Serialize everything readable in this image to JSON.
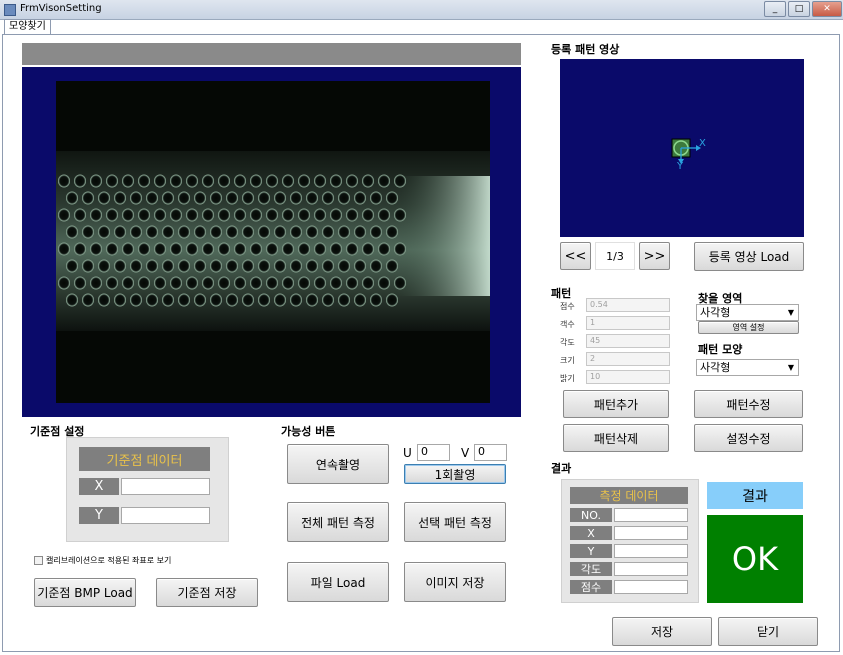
{
  "window": {
    "title": "FrmVisonSetting",
    "tab": "모양찾기"
  },
  "colors": {
    "accent_yellow": "#e9c24a",
    "navy": "#0a0a6a",
    "ok_green": "#008000",
    "result_blue": "#87cefa"
  },
  "reference": {
    "heading": "기준점 설정",
    "data_header": "기준점 데이터",
    "x_label": "X",
    "y_label": "Y",
    "x_value": "",
    "y_value": "",
    "calib_checkbox_label": "캘리브레이션으로 적용된 좌표로 보기",
    "bmp_load_button": "기준점 BMP Load",
    "save_button": "기준점 저장"
  },
  "functions": {
    "heading": "가능성 버튼",
    "continuous_button": "연속촬영",
    "u_label": "U",
    "u_value": "0",
    "v_label": "V",
    "v_value": "0",
    "single_shot_button": "1회촬영",
    "measure_all_button": "전체 패턴 측정",
    "measure_selected_button": "선택 패턴 측정",
    "file_load_button": "파일 Load",
    "image_save_button": "이미지 저장"
  },
  "registered": {
    "heading": "등록 패턴 영상",
    "prev_button": "<<",
    "page": "1/3",
    "next_button": ">>",
    "load_button": "등록 영상 Load",
    "axis_x": "X",
    "axis_y": "Y"
  },
  "pattern": {
    "heading": "패턴",
    "fields": [
      {
        "label": "점수",
        "value": "0.54"
      },
      {
        "label": "객수",
        "value": "1"
      },
      {
        "label": "각도",
        "value": "45"
      },
      {
        "label": "크기",
        "value": "2"
      },
      {
        "label": "밝기",
        "value": "10"
      }
    ],
    "search_area_label": "찾을 영역",
    "search_area_value": "사각형",
    "area_setting_button": "영역 설정",
    "shape_label": "패턴 모양",
    "shape_value": "사각형",
    "add_button": "패턴추가",
    "edit_button": "패턴수정",
    "delete_button": "패턴삭제",
    "setting_edit_button": "설정수정"
  },
  "result": {
    "heading": "결과",
    "data_header": "측정 데이터",
    "rows": [
      {
        "label": "NO.",
        "value": ""
      },
      {
        "label": "X",
        "value": ""
      },
      {
        "label": "Y",
        "value": ""
      },
      {
        "label": "각도",
        "value": ""
      },
      {
        "label": "점수",
        "value": ""
      }
    ],
    "result_label": "결과",
    "status": "OK"
  },
  "footer": {
    "save_button": "저장",
    "close_button": "닫기"
  }
}
